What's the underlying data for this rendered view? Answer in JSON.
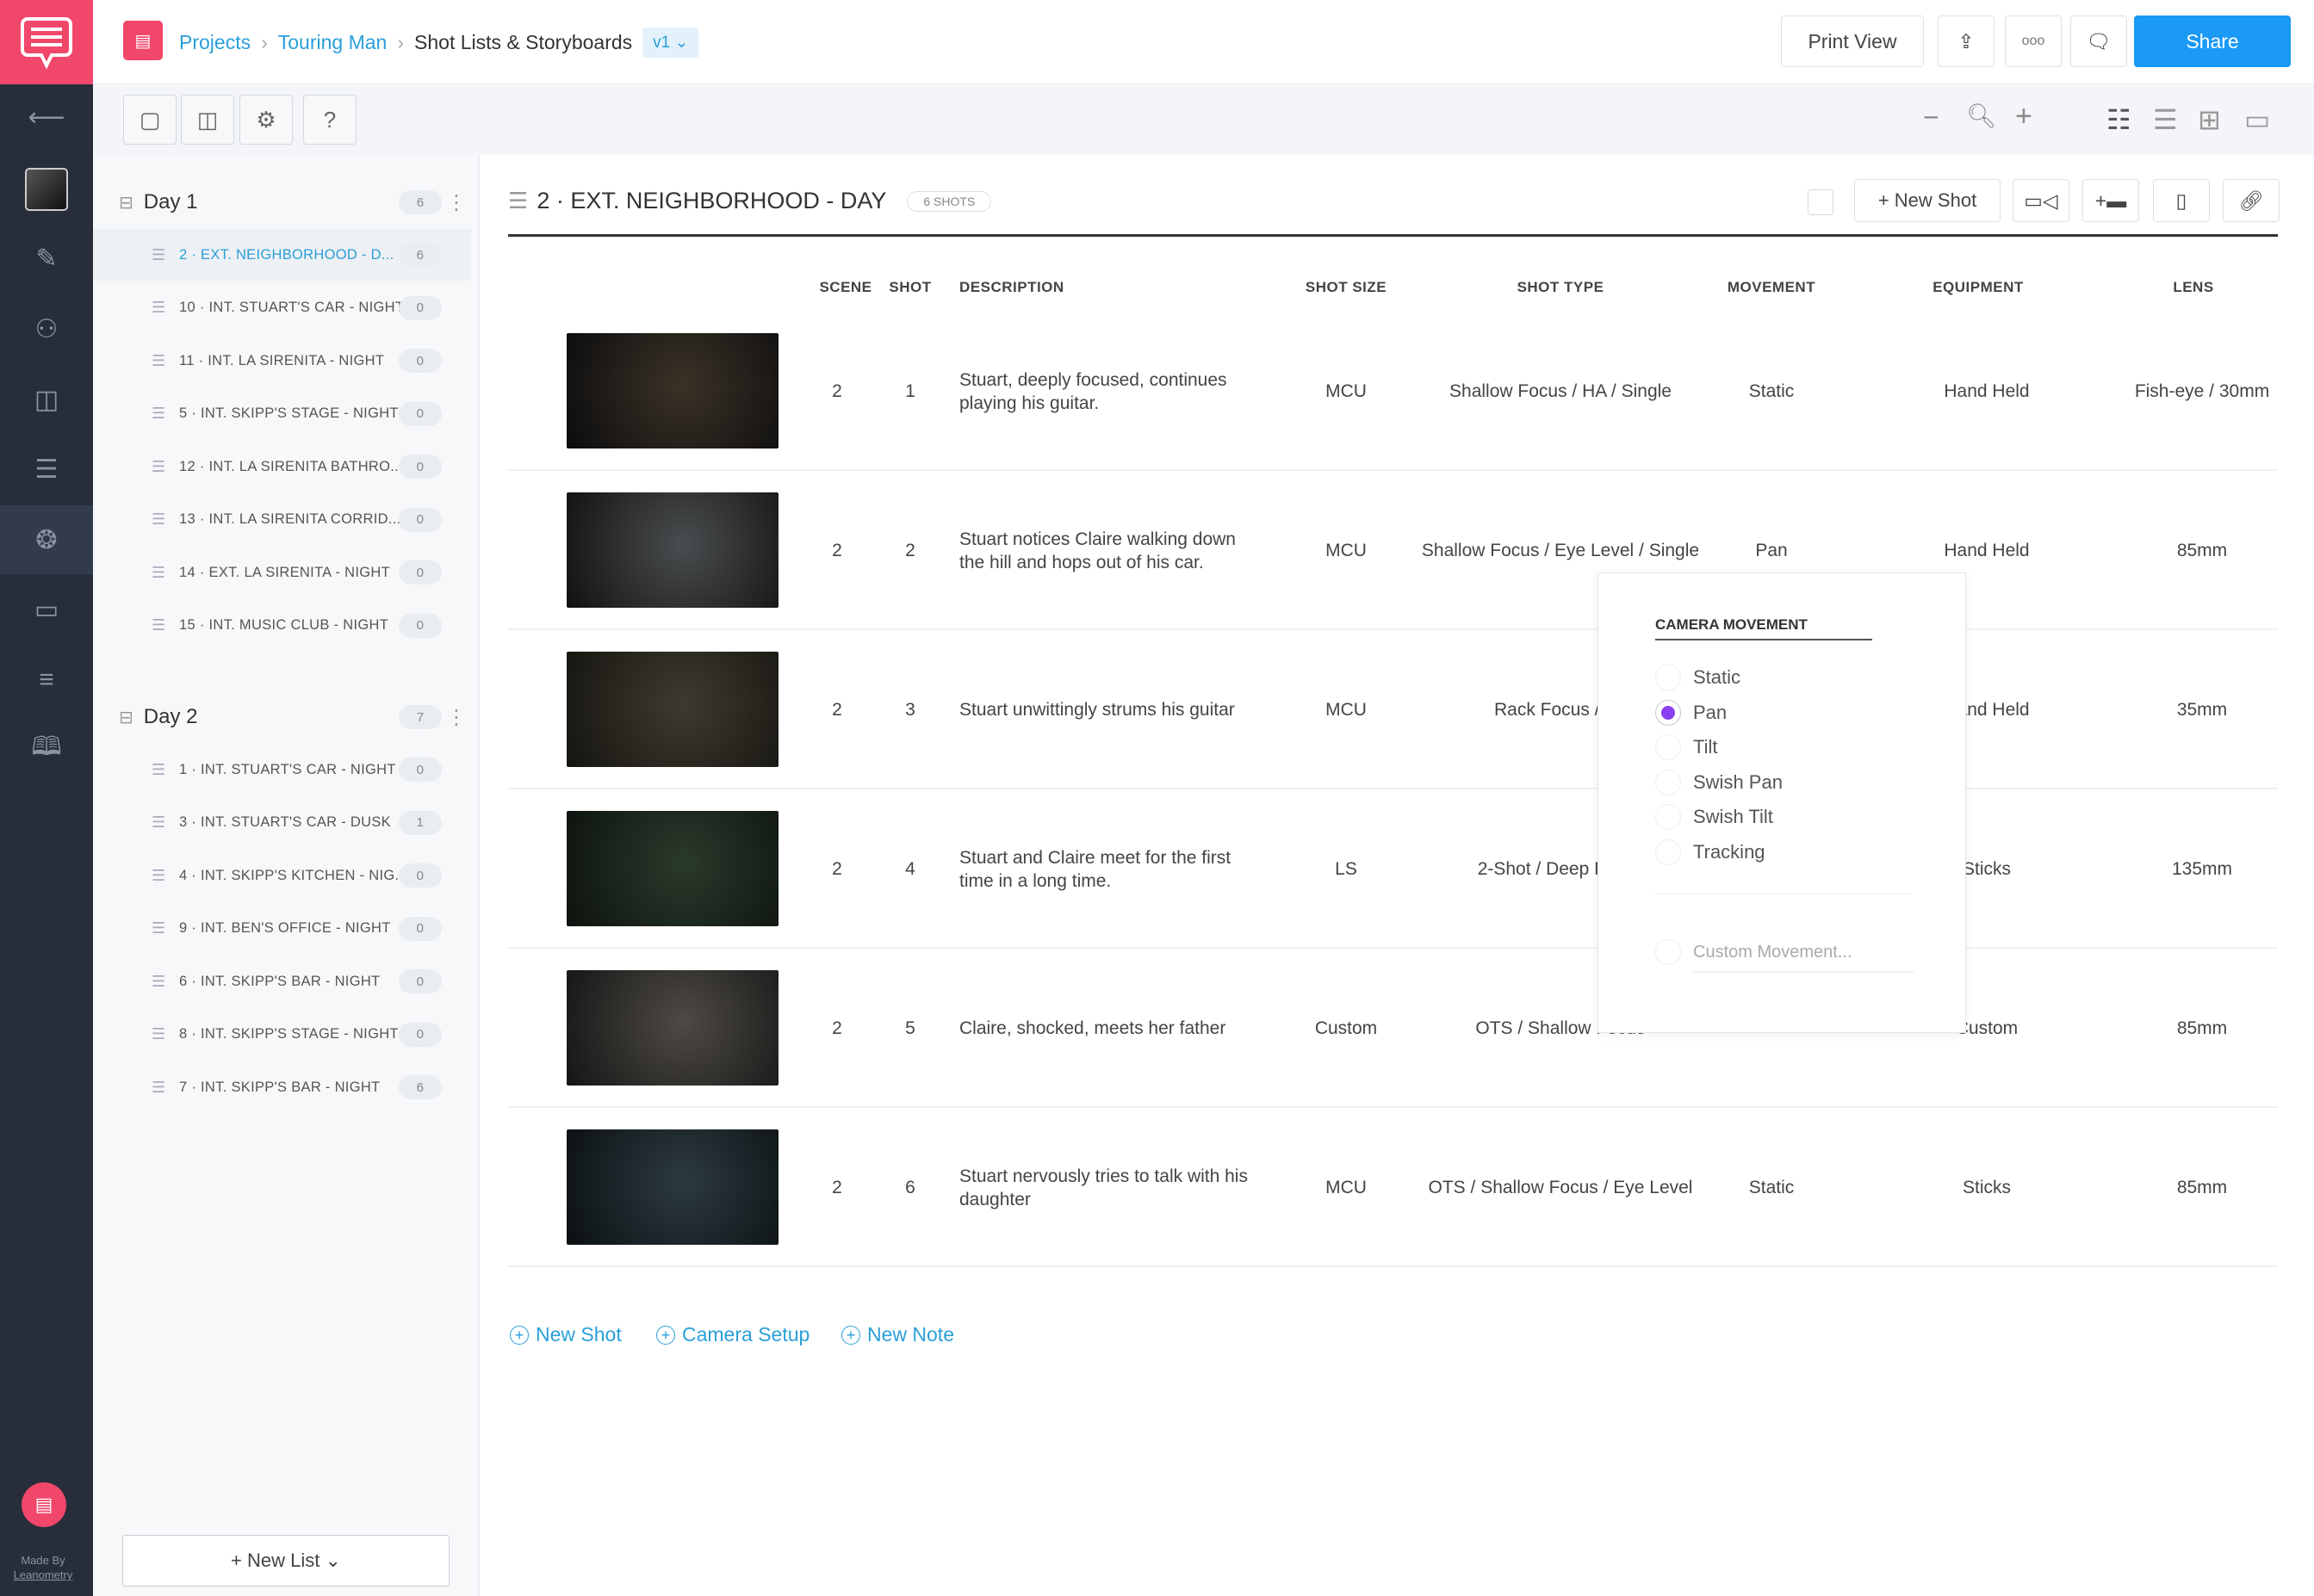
{
  "nav": {
    "made_by": "Made By",
    "company": "Leanometry",
    "items": [
      "back-arrow-icon",
      "project-thumbnail",
      "pencil-icon",
      "people-icon",
      "storyboard-icon",
      "list-icon",
      "aperture-icon",
      "calendar-icon",
      "sliders-icon",
      "book-info-icon"
    ]
  },
  "breadcrumb": {
    "projects": "Projects",
    "project": "Touring Man",
    "page": "Shot Lists & Storyboards",
    "version": "v1"
  },
  "header": {
    "print_view": "Print View",
    "share": "Share",
    "more": "ooo"
  },
  "colors": {
    "accent": "#2a9fd8",
    "brand": "#f0476b",
    "share": "#1a9af5",
    "radio": "#8a3ff0",
    "nav": "#272d3a"
  },
  "sidebar": {
    "days": [
      {
        "label": "Day 1",
        "count": "6",
        "scenes": [
          {
            "label": "2 · EXT. NEIGHBORHOOD - D...",
            "count": "6",
            "selected": true
          },
          {
            "label": "10 · INT. STUART'S CAR - NIGHT",
            "count": "0"
          },
          {
            "label": "11 · INT. LA SIRENITA - NIGHT",
            "count": "0"
          },
          {
            "label": "5 · INT. SKIPP'S STAGE - NIGHT",
            "count": "0"
          },
          {
            "label": "12 · INT. LA SIRENITA BATHRO...",
            "count": "0"
          },
          {
            "label": "13 · INT. LA SIRENITA CORRID...",
            "count": "0"
          },
          {
            "label": "14 · EXT. LA SIRENITA - NIGHT",
            "count": "0"
          },
          {
            "label": "15 · INT. MUSIC CLUB - NIGHT",
            "count": "0"
          }
        ]
      },
      {
        "label": "Day 2",
        "count": "7",
        "scenes": [
          {
            "label": "1 · INT. STUART'S CAR - NIGHT",
            "count": "0"
          },
          {
            "label": "3 · INT. STUART'S CAR - DUSK",
            "count": "1"
          },
          {
            "label": "4 · INT. SKIPP'S KITCHEN - NIG...",
            "count": "0"
          },
          {
            "label": "9 · INT. BEN'S OFFICE - NIGHT",
            "count": "0"
          },
          {
            "label": "6 · INT. SKIPP'S BAR - NIGHT",
            "count": "0"
          },
          {
            "label": "8 · INT. SKIPP'S STAGE - NIGHT",
            "count": "0"
          },
          {
            "label": "7 · INT. SKIPP'S BAR - NIGHT",
            "count": "6"
          }
        ]
      }
    ],
    "new_list": "+  New List"
  },
  "main": {
    "title": "2 · EXT. NEIGHBORHOOD - DAY",
    "shots_badge": "6 SHOTS",
    "new_shot": "New Shot",
    "columns": [
      "SCENE",
      "SHOT",
      "DESCRIPTION",
      "SHOT SIZE",
      "SHOT TYPE",
      "MOVEMENT",
      "EQUIPMENT",
      "LENS"
    ],
    "rows": [
      {
        "scene": "2",
        "shot": "1",
        "description": "Stuart, deeply focused, continues playing his guitar.",
        "size": "MCU",
        "type": "Shallow Focus / HA / Single",
        "movement": "Static",
        "equipment": "Hand Held",
        "lens": "Fish-eye / 30mm"
      },
      {
        "scene": "2",
        "shot": "2",
        "description": "Stuart notices Claire walking down the hill and hops out of his car.",
        "size": "MCU",
        "type": "Shallow Focus / Eye Level / Single",
        "movement": "Pan",
        "equipment": "Hand Held",
        "lens": "85mm"
      },
      {
        "scene": "2",
        "shot": "3",
        "description": "Stuart unwittingly strums his guitar",
        "size": "MCU",
        "type": "Rack Focus / LA",
        "movement": "",
        "equipment": "Hand Held",
        "lens": "35mm"
      },
      {
        "scene": "2",
        "shot": "4",
        "description": "Stuart and Claire meet for the first time in a long time.",
        "size": "LS",
        "type": "2-Shot / Deep Focus",
        "movement": "",
        "equipment": "Sticks",
        "lens": "135mm"
      },
      {
        "scene": "2",
        "shot": "5",
        "description": "Claire, shocked, meets her father",
        "size": "Custom",
        "type": "OTS / Shallow Focus",
        "movement": "",
        "equipment": "Custom",
        "lens": "85mm"
      },
      {
        "scene": "2",
        "shot": "6",
        "description": "Stuart nervously tries to talk with his daughter",
        "size": "MCU",
        "type": "OTS / Shallow Focus / Eye Level",
        "movement": "Static",
        "equipment": "Sticks",
        "lens": "85mm"
      }
    ],
    "add_links": [
      "New Shot",
      "Camera Setup",
      "New Note"
    ]
  },
  "popup": {
    "title": "CAMERA MOVEMENT",
    "options": [
      "Static",
      "Pan",
      "Tilt",
      "Swish Pan",
      "Swish Tilt",
      "Tracking"
    ],
    "selected": "Pan",
    "custom_placeholder": "Custom Movement..."
  }
}
